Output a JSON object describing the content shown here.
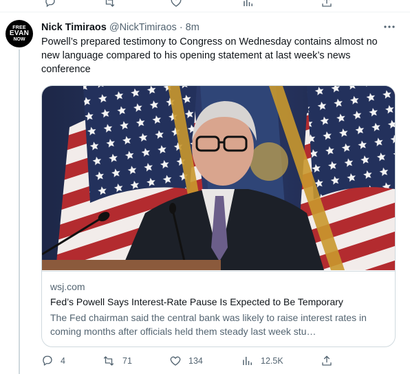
{
  "tweet": {
    "author": {
      "name": "Nick Timiraos",
      "handle": "@NickTimiraos",
      "avatar_text": [
        "FREE",
        "EVAN",
        "NOW"
      ]
    },
    "separator": "·",
    "time": "8m",
    "text": "Powell’s prepared testimony to Congress on Wednesday contains almost no new language compared to his opening statement at last week’s news conference",
    "card": {
      "image_subject": "Fed chairman at podium in front of American flags",
      "domain": "wsj.com",
      "title": "Fed’s Powell Says Interest-Rate Pause Is Expected to Be Temporary",
      "description": "The Fed chairman said the central bank was likely to raise interest rates in coming months after officials held them steady last week stu…"
    },
    "metrics": {
      "replies": "4",
      "retweets": "71",
      "likes": "134",
      "views": "12.5K"
    }
  },
  "icons": {
    "more": "more-icon",
    "reply": "reply-icon",
    "retweet": "retweet-icon",
    "like": "like-icon",
    "views": "views-icon",
    "share": "share-icon"
  },
  "colors": {
    "text": "#0f1419",
    "secondary": "#536471",
    "border": "#cfd9de",
    "thread_line": "#cfd9de"
  }
}
